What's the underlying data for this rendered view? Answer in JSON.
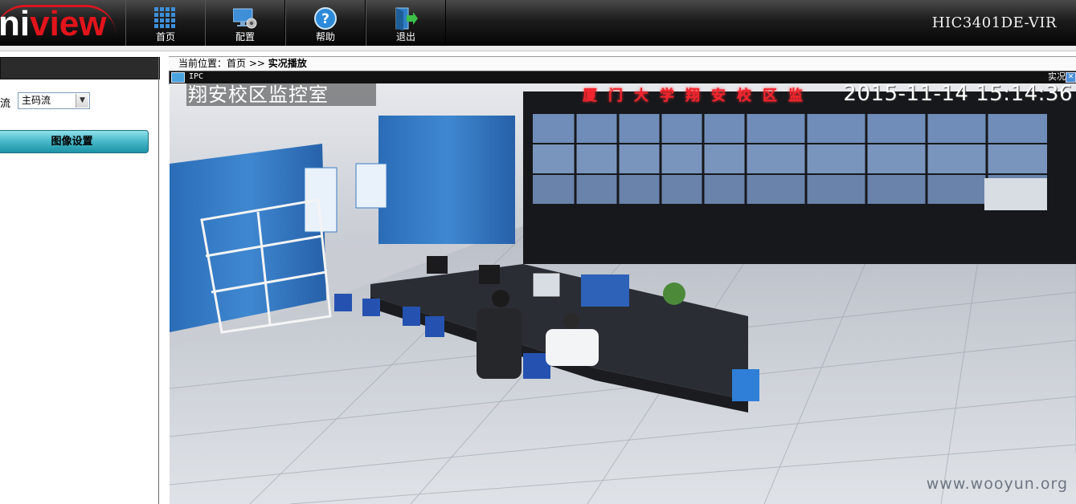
{
  "brand": {
    "logo_text_white": "ni",
    "logo_text_red": "view"
  },
  "nav": [
    {
      "label": "首页",
      "icon": "grid-icon"
    },
    {
      "label": "配置",
      "icon": "monitor-gear-icon"
    },
    {
      "label": "帮助",
      "icon": "help-icon"
    },
    {
      "label": "退出",
      "icon": "exit-door-icon"
    }
  ],
  "device_model": "HIC3401DE-VIR",
  "sidebar": {
    "stream_label": "流",
    "stream_select_value": "主码流",
    "image_settings_button": "图像设置"
  },
  "breadcrumb": {
    "prefix": "当前位置：",
    "home": "首页",
    "separator": ">>",
    "current": "实况播放"
  },
  "video_panel": {
    "channel_label": "IPC",
    "view_label": "实况",
    "osd_name": "翔安校区监控室",
    "osd_timestamp": "2015-11-14  15:14:36",
    "led_banner": "厦门大学翔安校区监",
    "watermark": "www.wooyun.org"
  },
  "colors": {
    "brand_red": "#e2141c",
    "button_teal": "#47b7c8",
    "topbar_dark": "#1c1c1c",
    "led_red": "#f4242e"
  }
}
